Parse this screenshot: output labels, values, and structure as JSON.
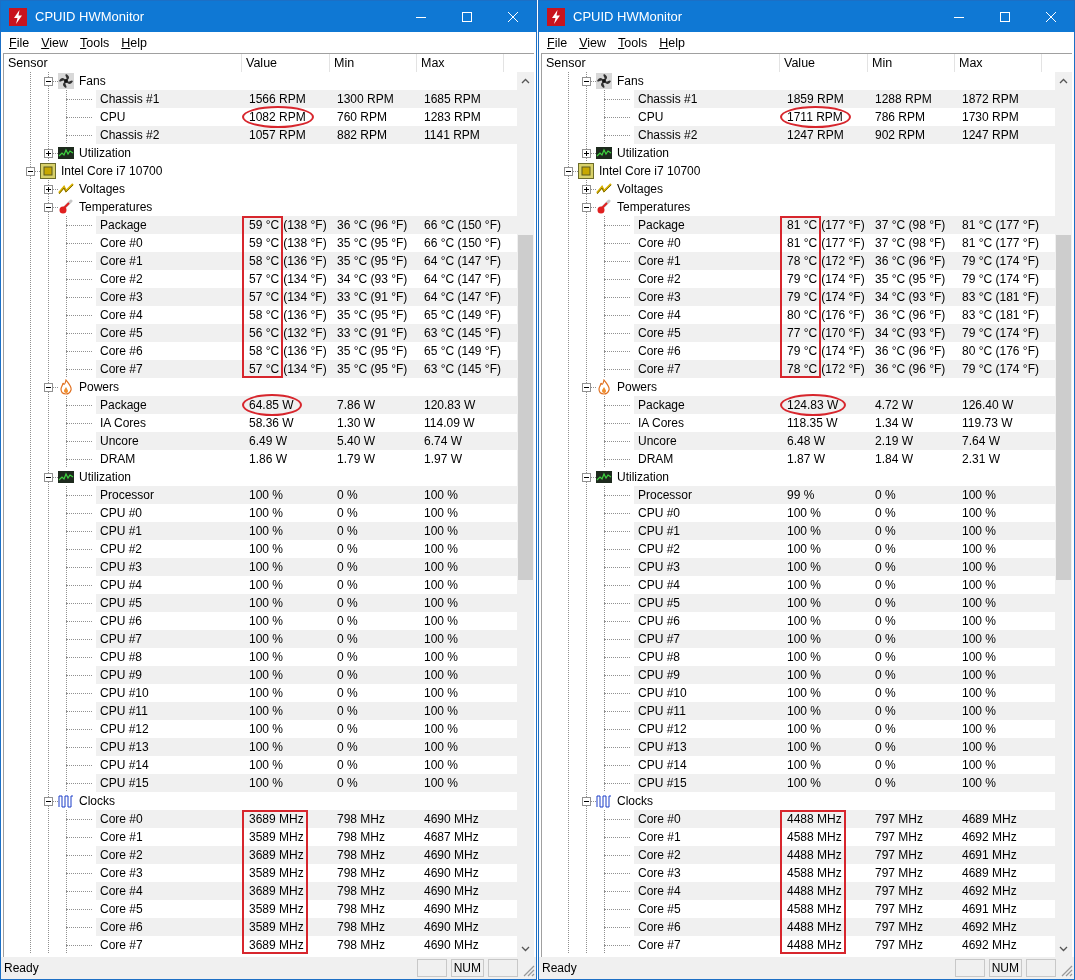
{
  "windows": [
    {
      "title": "CPUID HWMonitor",
      "menu": [
        "File",
        "View",
        "Tools",
        "Help"
      ],
      "columns": [
        "Sensor",
        "Value",
        "Min",
        "Max"
      ],
      "tree": [
        {
          "kind": "offscreen_parent",
          "children": [
            {
              "kind": "fans",
              "label": "Fans",
              "expanded": true,
              "children": [
                {
                  "kind": "sensor",
                  "label": "Chassis #1",
                  "value": "1566 RPM",
                  "min": "1300 RPM",
                  "max": "1685 RPM"
                },
                {
                  "kind": "sensor",
                  "label": "CPU",
                  "value": "1082 RPM",
                  "min": "760 RPM",
                  "max": "1283 RPM",
                  "circled": true
                },
                {
                  "kind": "sensor",
                  "label": "Chassis #2",
                  "value": "1057 RPM",
                  "min": "882 RPM",
                  "max": "1141 RPM"
                }
              ]
            },
            {
              "kind": "utilization",
              "label": "Utilization",
              "expanded": false
            }
          ]
        },
        {
          "kind": "processor",
          "label": "Intel Core i7 10700",
          "expanded": true,
          "children": [
            {
              "kind": "voltages",
              "label": "Voltages",
              "expanded": false
            },
            {
              "kind": "temperatures",
              "label": "Temperatures",
              "expanded": true,
              "boxed": true,
              "children": [
                {
                  "kind": "sensor",
                  "label": "Package",
                  "value": "59 °C",
                  "value_alt": "(138 °F)",
                  "min": "36 °C (96 °F)",
                  "max": "66 °C (150 °F)"
                },
                {
                  "kind": "sensor",
                  "label": "Core #0",
                  "value": "59 °C",
                  "value_alt": "(138 °F)",
                  "min": "35 °C (95 °F)",
                  "max": "66 °C (150 °F)"
                },
                {
                  "kind": "sensor",
                  "label": "Core #1",
                  "value": "58 °C",
                  "value_alt": "(136 °F)",
                  "min": "35 °C (95 °F)",
                  "max": "64 °C (147 °F)"
                },
                {
                  "kind": "sensor",
                  "label": "Core #2",
                  "value": "57 °C",
                  "value_alt": "(134 °F)",
                  "min": "34 °C (93 °F)",
                  "max": "64 °C (147 °F)"
                },
                {
                  "kind": "sensor",
                  "label": "Core #3",
                  "value": "57 °C",
                  "value_alt": "(134 °F)",
                  "min": "33 °C (91 °F)",
                  "max": "64 °C (147 °F)"
                },
                {
                  "kind": "sensor",
                  "label": "Core #4",
                  "value": "58 °C",
                  "value_alt": "(136 °F)",
                  "min": "35 °C (95 °F)",
                  "max": "65 °C (149 °F)"
                },
                {
                  "kind": "sensor",
                  "label": "Core #5",
                  "value": "56 °C",
                  "value_alt": "(132 °F)",
                  "min": "33 °C (91 °F)",
                  "max": "63 °C (145 °F)"
                },
                {
                  "kind": "sensor",
                  "label": "Core #6",
                  "value": "58 °C",
                  "value_alt": "(136 °F)",
                  "min": "35 °C (95 °F)",
                  "max": "65 °C (149 °F)"
                },
                {
                  "kind": "sensor",
                  "label": "Core #7",
                  "value": "57 °C",
                  "value_alt": "(134 °F)",
                  "min": "35 °C (95 °F)",
                  "max": "63 °C (145 °F)"
                }
              ]
            },
            {
              "kind": "powers",
              "label": "Powers",
              "expanded": true,
              "children": [
                {
                  "kind": "sensor",
                  "label": "Package",
                  "value": "64.85 W",
                  "min": "7.86 W",
                  "max": "120.83 W",
                  "circled": true
                },
                {
                  "kind": "sensor",
                  "label": "IA Cores",
                  "value": "58.36 W",
                  "min": "1.30 W",
                  "max": "114.09 W"
                },
                {
                  "kind": "sensor",
                  "label": "Uncore",
                  "value": "6.49 W",
                  "min": "5.40 W",
                  "max": "6.74 W"
                },
                {
                  "kind": "sensor",
                  "label": "DRAM",
                  "value": "1.86 W",
                  "min": "1.79 W",
                  "max": "1.97 W"
                }
              ]
            },
            {
              "kind": "utilization",
              "label": "Utilization",
              "expanded": true,
              "children": [
                {
                  "kind": "sensor",
                  "label": "Processor",
                  "value": "100 %",
                  "min": "0 %",
                  "max": "100 %"
                },
                {
                  "kind": "sensor",
                  "label": "CPU #0",
                  "value": "100 %",
                  "min": "0 %",
                  "max": "100 %"
                },
                {
                  "kind": "sensor",
                  "label": "CPU #1",
                  "value": "100 %",
                  "min": "0 %",
                  "max": "100 %"
                },
                {
                  "kind": "sensor",
                  "label": "CPU #2",
                  "value": "100 %",
                  "min": "0 %",
                  "max": "100 %"
                },
                {
                  "kind": "sensor",
                  "label": "CPU #3",
                  "value": "100 %",
                  "min": "0 %",
                  "max": "100 %"
                },
                {
                  "kind": "sensor",
                  "label": "CPU #4",
                  "value": "100 %",
                  "min": "0 %",
                  "max": "100 %"
                },
                {
                  "kind": "sensor",
                  "label": "CPU #5",
                  "value": "100 %",
                  "min": "0 %",
                  "max": "100 %"
                },
                {
                  "kind": "sensor",
                  "label": "CPU #6",
                  "value": "100 %",
                  "min": "0 %",
                  "max": "100 %"
                },
                {
                  "kind": "sensor",
                  "label": "CPU #7",
                  "value": "100 %",
                  "min": "0 %",
                  "max": "100 %"
                },
                {
                  "kind": "sensor",
                  "label": "CPU #8",
                  "value": "100 %",
                  "min": "0 %",
                  "max": "100 %"
                },
                {
                  "kind": "sensor",
                  "label": "CPU #9",
                  "value": "100 %",
                  "min": "0 %",
                  "max": "100 %"
                },
                {
                  "kind": "sensor",
                  "label": "CPU #10",
                  "value": "100 %",
                  "min": "0 %",
                  "max": "100 %"
                },
                {
                  "kind": "sensor",
                  "label": "CPU #11",
                  "value": "100 %",
                  "min": "0 %",
                  "max": "100 %"
                },
                {
                  "kind": "sensor",
                  "label": "CPU #12",
                  "value": "100 %",
                  "min": "0 %",
                  "max": "100 %"
                },
                {
                  "kind": "sensor",
                  "label": "CPU #13",
                  "value": "100 %",
                  "min": "0 %",
                  "max": "100 %"
                },
                {
                  "kind": "sensor",
                  "label": "CPU #14",
                  "value": "100 %",
                  "min": "0 %",
                  "max": "100 %"
                },
                {
                  "kind": "sensor",
                  "label": "CPU #15",
                  "value": "100 %",
                  "min": "0 %",
                  "max": "100 %"
                }
              ]
            },
            {
              "kind": "clocks",
              "label": "Clocks",
              "expanded": true,
              "boxed": true,
              "children": [
                {
                  "kind": "sensor",
                  "label": "Core #0",
                  "value": "3689 MHz",
                  "min": "798 MHz",
                  "max": "4690 MHz"
                },
                {
                  "kind": "sensor",
                  "label": "Core #1",
                  "value": "3589 MHz",
                  "min": "798 MHz",
                  "max": "4687 MHz"
                },
                {
                  "kind": "sensor",
                  "label": "Core #2",
                  "value": "3689 MHz",
                  "min": "798 MHz",
                  "max": "4690 MHz"
                },
                {
                  "kind": "sensor",
                  "label": "Core #3",
                  "value": "3589 MHz",
                  "min": "798 MHz",
                  "max": "4690 MHz"
                },
                {
                  "kind": "sensor",
                  "label": "Core #4",
                  "value": "3689 MHz",
                  "min": "798 MHz",
                  "max": "4690 MHz"
                },
                {
                  "kind": "sensor",
                  "label": "Core #5",
                  "value": "3589 MHz",
                  "min": "798 MHz",
                  "max": "4690 MHz"
                },
                {
                  "kind": "sensor",
                  "label": "Core #6",
                  "value": "3589 MHz",
                  "min": "798 MHz",
                  "max": "4690 MHz"
                },
                {
                  "kind": "sensor",
                  "label": "Core #7",
                  "value": "3689 MHz",
                  "min": "798 MHz",
                  "max": "4690 MHz"
                }
              ]
            }
          ]
        }
      ],
      "status_bar": {
        "text": "Ready",
        "indicator": "NUM"
      }
    },
    {
      "title": "CPUID HWMonitor",
      "menu": [
        "File",
        "View",
        "Tools",
        "Help"
      ],
      "columns": [
        "Sensor",
        "Value",
        "Min",
        "Max"
      ],
      "tree": [
        {
          "kind": "offscreen_parent",
          "children": [
            {
              "kind": "fans",
              "label": "Fans",
              "expanded": true,
              "children": [
                {
                  "kind": "sensor",
                  "label": "Chassis #1",
                  "value": "1859 RPM",
                  "min": "1288 RPM",
                  "max": "1872 RPM"
                },
                {
                  "kind": "sensor",
                  "label": "CPU",
                  "value": "1711 RPM",
                  "min": "786 RPM",
                  "max": "1730 RPM",
                  "circled": true
                },
                {
                  "kind": "sensor",
                  "label": "Chassis #2",
                  "value": "1247 RPM",
                  "min": "902 RPM",
                  "max": "1247 RPM"
                }
              ]
            },
            {
              "kind": "utilization",
              "label": "Utilization",
              "expanded": false
            }
          ]
        },
        {
          "kind": "processor",
          "label": "Intel Core i7 10700",
          "expanded": true,
          "children": [
            {
              "kind": "voltages",
              "label": "Voltages",
              "expanded": false
            },
            {
              "kind": "temperatures",
              "label": "Temperatures",
              "expanded": true,
              "boxed": true,
              "children": [
                {
                  "kind": "sensor",
                  "label": "Package",
                  "value": "81 °C",
                  "value_alt": "(177 °F)",
                  "min": "37 °C (98 °F)",
                  "max": "81 °C (177 °F)"
                },
                {
                  "kind": "sensor",
                  "label": "Core #0",
                  "value": "81 °C",
                  "value_alt": "(177 °F)",
                  "min": "37 °C (98 °F)",
                  "max": "81 °C (177 °F)"
                },
                {
                  "kind": "sensor",
                  "label": "Core #1",
                  "value": "78 °C",
                  "value_alt": "(172 °F)",
                  "min": "36 °C (96 °F)",
                  "max": "79 °C (174 °F)"
                },
                {
                  "kind": "sensor",
                  "label": "Core #2",
                  "value": "79 °C",
                  "value_alt": "(174 °F)",
                  "min": "35 °C (95 °F)",
                  "max": "79 °C (174 °F)"
                },
                {
                  "kind": "sensor",
                  "label": "Core #3",
                  "value": "79 °C",
                  "value_alt": "(174 °F)",
                  "min": "34 °C (93 °F)",
                  "max": "83 °C (181 °F)"
                },
                {
                  "kind": "sensor",
                  "label": "Core #4",
                  "value": "80 °C",
                  "value_alt": "(176 °F)",
                  "min": "36 °C (96 °F)",
                  "max": "83 °C (181 °F)"
                },
                {
                  "kind": "sensor",
                  "label": "Core #5",
                  "value": "77 °C",
                  "value_alt": "(170 °F)",
                  "min": "34 °C (93 °F)",
                  "max": "79 °C (174 °F)"
                },
                {
                  "kind": "sensor",
                  "label": "Core #6",
                  "value": "79 °C",
                  "value_alt": "(174 °F)",
                  "min": "36 °C (96 °F)",
                  "max": "80 °C (176 °F)"
                },
                {
                  "kind": "sensor",
                  "label": "Core #7",
                  "value": "78 °C",
                  "value_alt": "(172 °F)",
                  "min": "36 °C (96 °F)",
                  "max": "79 °C (174 °F)"
                }
              ]
            },
            {
              "kind": "powers",
              "label": "Powers",
              "expanded": true,
              "children": [
                {
                  "kind": "sensor",
                  "label": "Package",
                  "value": "124.83 W",
                  "min": "4.72 W",
                  "max": "126.40 W",
                  "circled": true
                },
                {
                  "kind": "sensor",
                  "label": "IA Cores",
                  "value": "118.35 W",
                  "min": "1.34 W",
                  "max": "119.73 W"
                },
                {
                  "kind": "sensor",
                  "label": "Uncore",
                  "value": "6.48 W",
                  "min": "2.19 W",
                  "max": "7.64 W"
                },
                {
                  "kind": "sensor",
                  "label": "DRAM",
                  "value": "1.87 W",
                  "min": "1.84 W",
                  "max": "2.31 W"
                }
              ]
            },
            {
              "kind": "utilization",
              "label": "Utilization",
              "expanded": true,
              "children": [
                {
                  "kind": "sensor",
                  "label": "Processor",
                  "value": "99 %",
                  "min": "0 %",
                  "max": "100 %"
                },
                {
                  "kind": "sensor",
                  "label": "CPU #0",
                  "value": "100 %",
                  "min": "0 %",
                  "max": "100 %"
                },
                {
                  "kind": "sensor",
                  "label": "CPU #1",
                  "value": "100 %",
                  "min": "0 %",
                  "max": "100 %"
                },
                {
                  "kind": "sensor",
                  "label": "CPU #2",
                  "value": "100 %",
                  "min": "0 %",
                  "max": "100 %"
                },
                {
                  "kind": "sensor",
                  "label": "CPU #3",
                  "value": "100 %",
                  "min": "0 %",
                  "max": "100 %"
                },
                {
                  "kind": "sensor",
                  "label": "CPU #4",
                  "value": "100 %",
                  "min": "0 %",
                  "max": "100 %"
                },
                {
                  "kind": "sensor",
                  "label": "CPU #5",
                  "value": "100 %",
                  "min": "0 %",
                  "max": "100 %"
                },
                {
                  "kind": "sensor",
                  "label": "CPU #6",
                  "value": "100 %",
                  "min": "0 %",
                  "max": "100 %"
                },
                {
                  "kind": "sensor",
                  "label": "CPU #7",
                  "value": "100 %",
                  "min": "0 %",
                  "max": "100 %"
                },
                {
                  "kind": "sensor",
                  "label": "CPU #8",
                  "value": "100 %",
                  "min": "0 %",
                  "max": "100 %"
                },
                {
                  "kind": "sensor",
                  "label": "CPU #9",
                  "value": "100 %",
                  "min": "0 %",
                  "max": "100 %"
                },
                {
                  "kind": "sensor",
                  "label": "CPU #10",
                  "value": "100 %",
                  "min": "0 %",
                  "max": "100 %"
                },
                {
                  "kind": "sensor",
                  "label": "CPU #11",
                  "value": "100 %",
                  "min": "0 %",
                  "max": "100 %"
                },
                {
                  "kind": "sensor",
                  "label": "CPU #12",
                  "value": "100 %",
                  "min": "0 %",
                  "max": "100 %"
                },
                {
                  "kind": "sensor",
                  "label": "CPU #13",
                  "value": "100 %",
                  "min": "0 %",
                  "max": "100 %"
                },
                {
                  "kind": "sensor",
                  "label": "CPU #14",
                  "value": "100 %",
                  "min": "0 %",
                  "max": "100 %"
                },
                {
                  "kind": "sensor",
                  "label": "CPU #15",
                  "value": "100 %",
                  "min": "0 %",
                  "max": "100 %"
                }
              ]
            },
            {
              "kind": "clocks",
              "label": "Clocks",
              "expanded": true,
              "boxed": true,
              "children": [
                {
                  "kind": "sensor",
                  "label": "Core #0",
                  "value": "4488 MHz",
                  "min": "797 MHz",
                  "max": "4689 MHz"
                },
                {
                  "kind": "sensor",
                  "label": "Core #1",
                  "value": "4588 MHz",
                  "min": "797 MHz",
                  "max": "4692 MHz"
                },
                {
                  "kind": "sensor",
                  "label": "Core #2",
                  "value": "4488 MHz",
                  "min": "797 MHz",
                  "max": "4691 MHz"
                },
                {
                  "kind": "sensor",
                  "label": "Core #3",
                  "value": "4588 MHz",
                  "min": "797 MHz",
                  "max": "4689 MHz"
                },
                {
                  "kind": "sensor",
                  "label": "Core #4",
                  "value": "4488 MHz",
                  "min": "797 MHz",
                  "max": "4692 MHz"
                },
                {
                  "kind": "sensor",
                  "label": "Core #5",
                  "value": "4588 MHz",
                  "min": "797 MHz",
                  "max": "4691 MHz"
                },
                {
                  "kind": "sensor",
                  "label": "Core #6",
                  "value": "4488 MHz",
                  "min": "797 MHz",
                  "max": "4692 MHz"
                },
                {
                  "kind": "sensor",
                  "label": "Core #7",
                  "value": "4488 MHz",
                  "min": "797 MHz",
                  "max": "4692 MHz"
                }
              ]
            }
          ]
        }
      ],
      "status_bar": {
        "text": "Ready",
        "indicator": "NUM"
      }
    }
  ]
}
